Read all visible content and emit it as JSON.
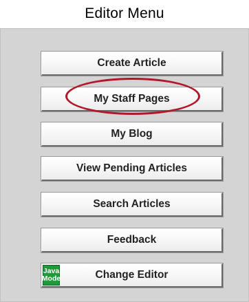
{
  "title": "Editor Menu",
  "buttons": [
    {
      "label": "Create Article"
    },
    {
      "label": "My Staff Pages"
    },
    {
      "label": "My Blog"
    },
    {
      "label": "View Pending Articles"
    },
    {
      "label": "Search Articles"
    },
    {
      "label": "Feedback"
    },
    {
      "label": "Change Editor"
    }
  ],
  "change_editor_badge": {
    "line1": "Java",
    "line2": "Mode",
    "color": "#1f9a3a"
  },
  "highlight": {
    "target": "My Staff Pages",
    "color": "#b2182b"
  }
}
